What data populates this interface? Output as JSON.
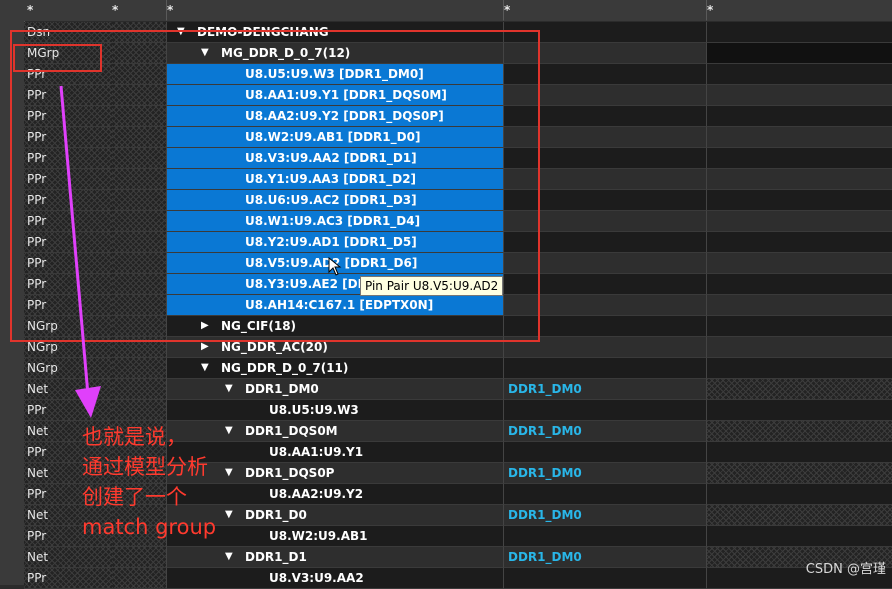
{
  "header": [
    "*",
    "*",
    "*",
    "*",
    "*"
  ],
  "rows": [
    {
      "type": "Dsn",
      "indent": 0,
      "expanded": true,
      "label": "DEMO-DENGCHANG",
      "net": "",
      "c4": "normal"
    },
    {
      "type": "MGrp",
      "indent": 1,
      "expanded": true,
      "label": "MG_DDR_D_0_7(12)",
      "net": "",
      "c4": "dark"
    },
    {
      "type": "PPr",
      "indent": 2,
      "label": "U8.U5:U9.W3 [DDR1_DM0]",
      "selected": true
    },
    {
      "type": "PPr",
      "indent": 2,
      "label": "U8.AA1:U9.Y1 [DDR1_DQS0M]",
      "selected": true
    },
    {
      "type": "PPr",
      "indent": 2,
      "label": "U8.AA2:U9.Y2 [DDR1_DQS0P]",
      "selected": true
    },
    {
      "type": "PPr",
      "indent": 2,
      "label": "U8.W2:U9.AB1 [DDR1_D0]",
      "selected": true
    },
    {
      "type": "PPr",
      "indent": 2,
      "label": "U8.V3:U9.AA2 [DDR1_D1]",
      "selected": true
    },
    {
      "type": "PPr",
      "indent": 2,
      "label": "U8.Y1:U9.AA3 [DDR1_D2]",
      "selected": true
    },
    {
      "type": "PPr",
      "indent": 2,
      "label": "U8.U6:U9.AC2 [DDR1_D3]",
      "selected": true
    },
    {
      "type": "PPr",
      "indent": 2,
      "label": "U8.W1:U9.AC3 [DDR1_D4]",
      "selected": true
    },
    {
      "type": "PPr",
      "indent": 2,
      "label": "U8.Y2:U9.AD1 [DDR1_D5]",
      "selected": true
    },
    {
      "type": "PPr",
      "indent": 2,
      "label": "U8.V5:U9.AD2 [DDR1_D6]",
      "selected": true
    },
    {
      "type": "PPr",
      "indent": 2,
      "label": "U8.Y3:U9.AE2 [DDR1_D7]",
      "selected": true
    },
    {
      "type": "PPr",
      "indent": 2,
      "label": "U8.AH14:C167.1 [EDPTX0N]",
      "selected": true
    },
    {
      "type": "NGrp",
      "indent": 1,
      "expanded": false,
      "label": "NG_CIF(18)"
    },
    {
      "type": "NGrp",
      "indent": 1,
      "expanded": false,
      "label": "NG_DDR_AC(20)"
    },
    {
      "type": "NGrp",
      "indent": 1,
      "expanded": true,
      "label": "NG_DDR_D_0_7(11)"
    },
    {
      "type": "Net",
      "indent": 2,
      "expanded": true,
      "label": "DDR1_DM0",
      "net": "DDR1_DM0"
    },
    {
      "type": "PPr",
      "indent": 3,
      "label": "U8.U5:U9.W3"
    },
    {
      "type": "Net",
      "indent": 2,
      "expanded": true,
      "label": "DDR1_DQS0M",
      "net": "DDR1_DM0"
    },
    {
      "type": "PPr",
      "indent": 3,
      "label": "U8.AA1:U9.Y1"
    },
    {
      "type": "Net",
      "indent": 2,
      "expanded": true,
      "label": "DDR1_DQS0P",
      "net": "DDR1_DM0"
    },
    {
      "type": "PPr",
      "indent": 3,
      "label": "U8.AA2:U9.Y2"
    },
    {
      "type": "Net",
      "indent": 2,
      "expanded": true,
      "label": "DDR1_D0",
      "net": "DDR1_DM0"
    },
    {
      "type": "PPr",
      "indent": 3,
      "label": "U8.W2:U9.AB1"
    },
    {
      "type": "Net",
      "indent": 2,
      "expanded": true,
      "label": "DDR1_D1",
      "net": "DDR1_DM0"
    },
    {
      "type": "PPr",
      "indent": 3,
      "label": "U8.V3:U9.AA2"
    }
  ],
  "tooltip": "Pin Pair U8.V5:U9.AD2",
  "annotation": [
    "也就是说，",
    "通过模型分析",
    "创建了一个",
    "match group"
  ],
  "watermark": "CSDN @宫瑾",
  "colors": {
    "selection": "#0a78d4",
    "net_value": "#29b6e8",
    "annotation": "#ff3a2e",
    "highlight_box": "#e0342c",
    "arrow": "#e040fb"
  }
}
